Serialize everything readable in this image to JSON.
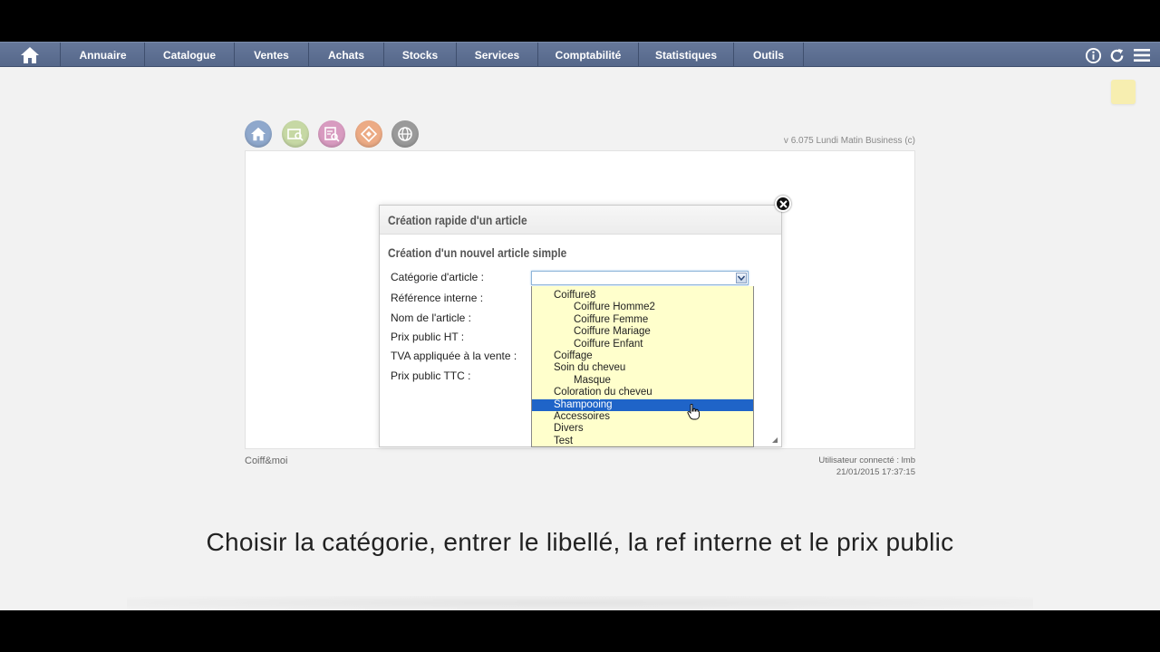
{
  "nav": {
    "items": [
      {
        "label": "Annuaire"
      },
      {
        "label": "Catalogue"
      },
      {
        "label": "Ventes"
      },
      {
        "label": "Achats"
      },
      {
        "label": "Stocks"
      },
      {
        "label": "Services"
      },
      {
        "label": "Comptabilité"
      },
      {
        "label": "Statistiques"
      },
      {
        "label": "Outils"
      }
    ],
    "icons": [
      "home-icon",
      "info-icon",
      "refresh-icon",
      "menu-icon"
    ],
    "color": "#5f7193"
  },
  "toolbar": {
    "icons": [
      "home-icon",
      "catalog-search-icon",
      "document-search-icon",
      "sales-icon",
      "globe-icon"
    ],
    "colors": [
      "#8fa8cc",
      "#c6d8a4",
      "#d89bc0",
      "#ecab85",
      "#9a9a9a"
    ]
  },
  "version": "v 6.075 Lundi Matin Business (c)",
  "dialog": {
    "title": "Création rapide d'un article",
    "subtitle": "Création d'un nouvel article simple",
    "fields": [
      {
        "label": "Catégorie d'article :"
      },
      {
        "label": "Référence interne :"
      },
      {
        "label": "Nom de l'article :"
      },
      {
        "label": "Prix public HT :"
      },
      {
        "label": "TVA appliquée à la vente :"
      },
      {
        "label": "Prix public TTC :"
      }
    ],
    "category_value": "",
    "dropdown_options": [
      {
        "label": "Coiffure8",
        "level": 1
      },
      {
        "label": "Coiffure Homme2",
        "level": 2
      },
      {
        "label": "Coiffure Femme",
        "level": 2
      },
      {
        "label": "Coiffure Mariage",
        "level": 2
      },
      {
        "label": "Coiffure Enfant",
        "level": 2
      },
      {
        "label": "Coiffage",
        "level": 1
      },
      {
        "label": "Soin du cheveu",
        "level": 1
      },
      {
        "label": "Masque",
        "level": 2
      },
      {
        "label": "Coloration du cheveu",
        "level": 1
      },
      {
        "label": "Shampooing",
        "level": 1,
        "selected": true
      },
      {
        "label": "Accessoires",
        "level": 1
      },
      {
        "label": "Divers",
        "level": 1
      },
      {
        "label": "Test",
        "level": 1
      }
    ],
    "dropdown_bg": "#ffffcc",
    "selected_color": "#1f64c8"
  },
  "footer": {
    "company": "Coiff&moi",
    "user": "Utilisateur connecté : lmb",
    "datetime": "21/01/2015 17:37:15"
  },
  "caption": "Choisir la catégorie, entrer le libellé, la ref interne et le prix public"
}
